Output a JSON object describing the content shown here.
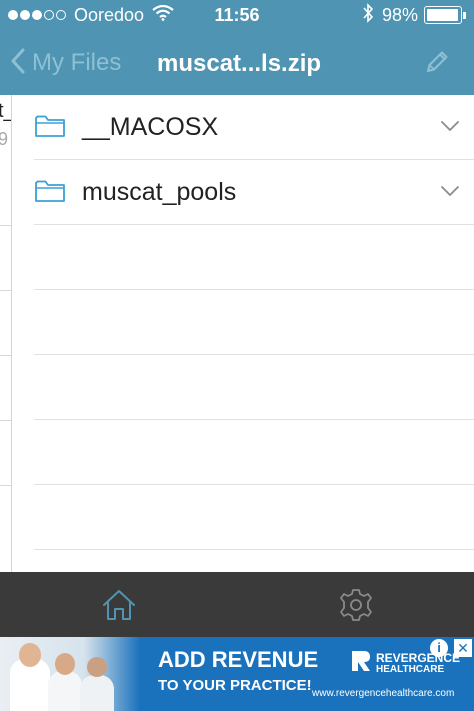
{
  "status_bar": {
    "signal_bars_filled": 3,
    "signal_bars_total": 5,
    "carrier": "Ooredoo",
    "wifi_icon": "wifi-icon",
    "time": "11:56",
    "bluetooth_icon": "bluetooth-icon",
    "battery_percent": "98%",
    "battery_level": 0.98
  },
  "nav_bar": {
    "back_label": "My Files",
    "title": "muscat...ls.zip",
    "edit_icon": "pencil-icon"
  },
  "background_panel": {
    "line1": "t_",
    "line2": "9"
  },
  "files": [
    {
      "name": "__MACOSX",
      "icon": "folder-icon",
      "action_icon": "chevron-down-icon"
    },
    {
      "name": "muscat_pools",
      "icon": "folder-icon",
      "action_icon": "chevron-down-icon"
    }
  ],
  "tab_bar": {
    "tabs": [
      {
        "icon": "home-icon",
        "selected": true
      },
      {
        "icon": "gear-icon",
        "selected": false
      }
    ]
  },
  "ad": {
    "headline": "ADD REVENUE",
    "subheadline": "TO YOUR PRACTICE!",
    "brand_line1": "REVERGENCE",
    "brand_line2": "HEALTHCARE",
    "url": "www.revergencehealthcare.com",
    "info_label": "i",
    "close_label": "✕"
  },
  "colors": {
    "bar_blue": "#4f94b2",
    "back_text": "#8ec0d4",
    "folder_blue": "#3aa0d8",
    "tab_bar": "#3a3a3a",
    "ad_blue": "#1a72bd"
  }
}
